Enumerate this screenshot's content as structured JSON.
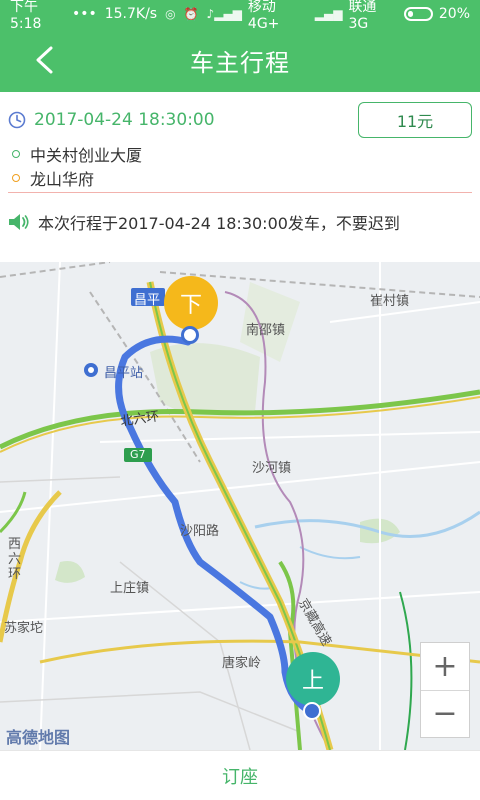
{
  "status_bar": {
    "time": "下午5:18",
    "dots": "•••",
    "net_speed": "15.7K/s",
    "carrier1": "移动 4G+",
    "carrier2": "联通 3G",
    "battery": "20%",
    "battery_level": 0.2
  },
  "header": {
    "title": "车主行程",
    "back_icon": "chevron-left-icon"
  },
  "trip": {
    "time_icon": "clock-icon",
    "departure_time": "2017-04-24 18:30:00",
    "price": "11元",
    "start_place": "中关村创业大厦",
    "end_place": "龙山华府",
    "notice_icon": "speaker-icon",
    "notice": "本次行程于2017-04-24 18:30:00发车，不要迟到"
  },
  "map": {
    "labels": {
      "cuicunzhen": "崔村镇",
      "nanshaozhen": "南邵镇",
      "changpingzhan": "昌平站",
      "changping_tag": "昌平",
      "beiliuhuan": "北六环",
      "g7": "G7",
      "shahezhen": "沙河镇",
      "shayanglu": "沙阳路",
      "xiliuhuan": "西六环",
      "shangzhuangzhen": "上庄镇",
      "sujiatuo": "苏家坨",
      "tangjialing": "唐家岭",
      "jingzang": "京藏高速"
    },
    "end_marker": "下",
    "start_marker": "上",
    "watermark": "高德地图",
    "zoom_in": "+",
    "zoom_out": "−",
    "colors": {
      "route": "#4a77e0",
      "end_marker": "#f5b81b",
      "start_marker": "#2fb594",
      "highway": "#e7c94b",
      "highway_green": "#7cc64a"
    }
  },
  "bottom": {
    "book_label": "订座"
  }
}
